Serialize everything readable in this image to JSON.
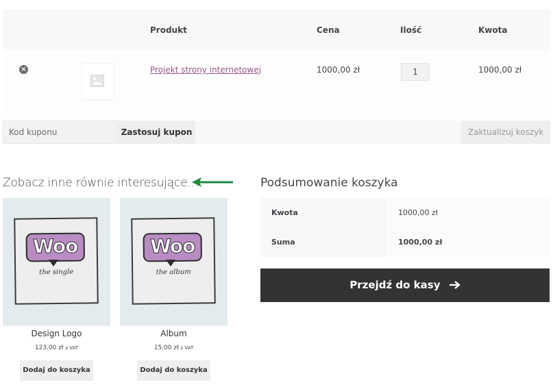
{
  "cart": {
    "headers": {
      "product": "Produkt",
      "price": "Cena",
      "quantity": "Ilość",
      "subtotal": "Kwota"
    },
    "item": {
      "remove_symbol": "×",
      "name": "Projekt strony internetowej",
      "price": "1000,00 zł",
      "quantity": "1",
      "subtotal": "1000,00 zł",
      "thumbnail_icon": "image-placeholder-icon"
    }
  },
  "actions": {
    "coupon_placeholder": "Kod kuponu",
    "apply_coupon": "Zastosuj kupon",
    "update_cart": "Zaktualizuj koszyk"
  },
  "cross_sells": {
    "title": "Zobacz inne równie interesujące…",
    "products": [
      {
        "name": "Design Logo",
        "price": "123,00 zł",
        "vat": "z VAT",
        "button": "Dodaj do koszyka",
        "image_logo": "Woo",
        "image_caption": "the single"
      },
      {
        "name": "Album",
        "price": "15,00 zł",
        "vat": "z VAT",
        "button": "Dodaj do koszyka",
        "image_logo": "Woo",
        "image_caption": "the album"
      }
    ]
  },
  "totals": {
    "title": "Podsumowanie koszyka",
    "subtotal_label": "Kwota",
    "subtotal_value": "1000,00 zł",
    "total_label": "Suma",
    "total_value": "1000,00 zł"
  },
  "checkout": {
    "label": "Przejdź do kasy",
    "icon": "arrow-right-icon"
  },
  "annotation": {
    "arrow_color": "#1e8a3c",
    "icon": "green-arrow-icon"
  },
  "colors": {
    "link": "#96588a",
    "dark_button": "#333333",
    "woo_purple": "#b98cc4"
  }
}
